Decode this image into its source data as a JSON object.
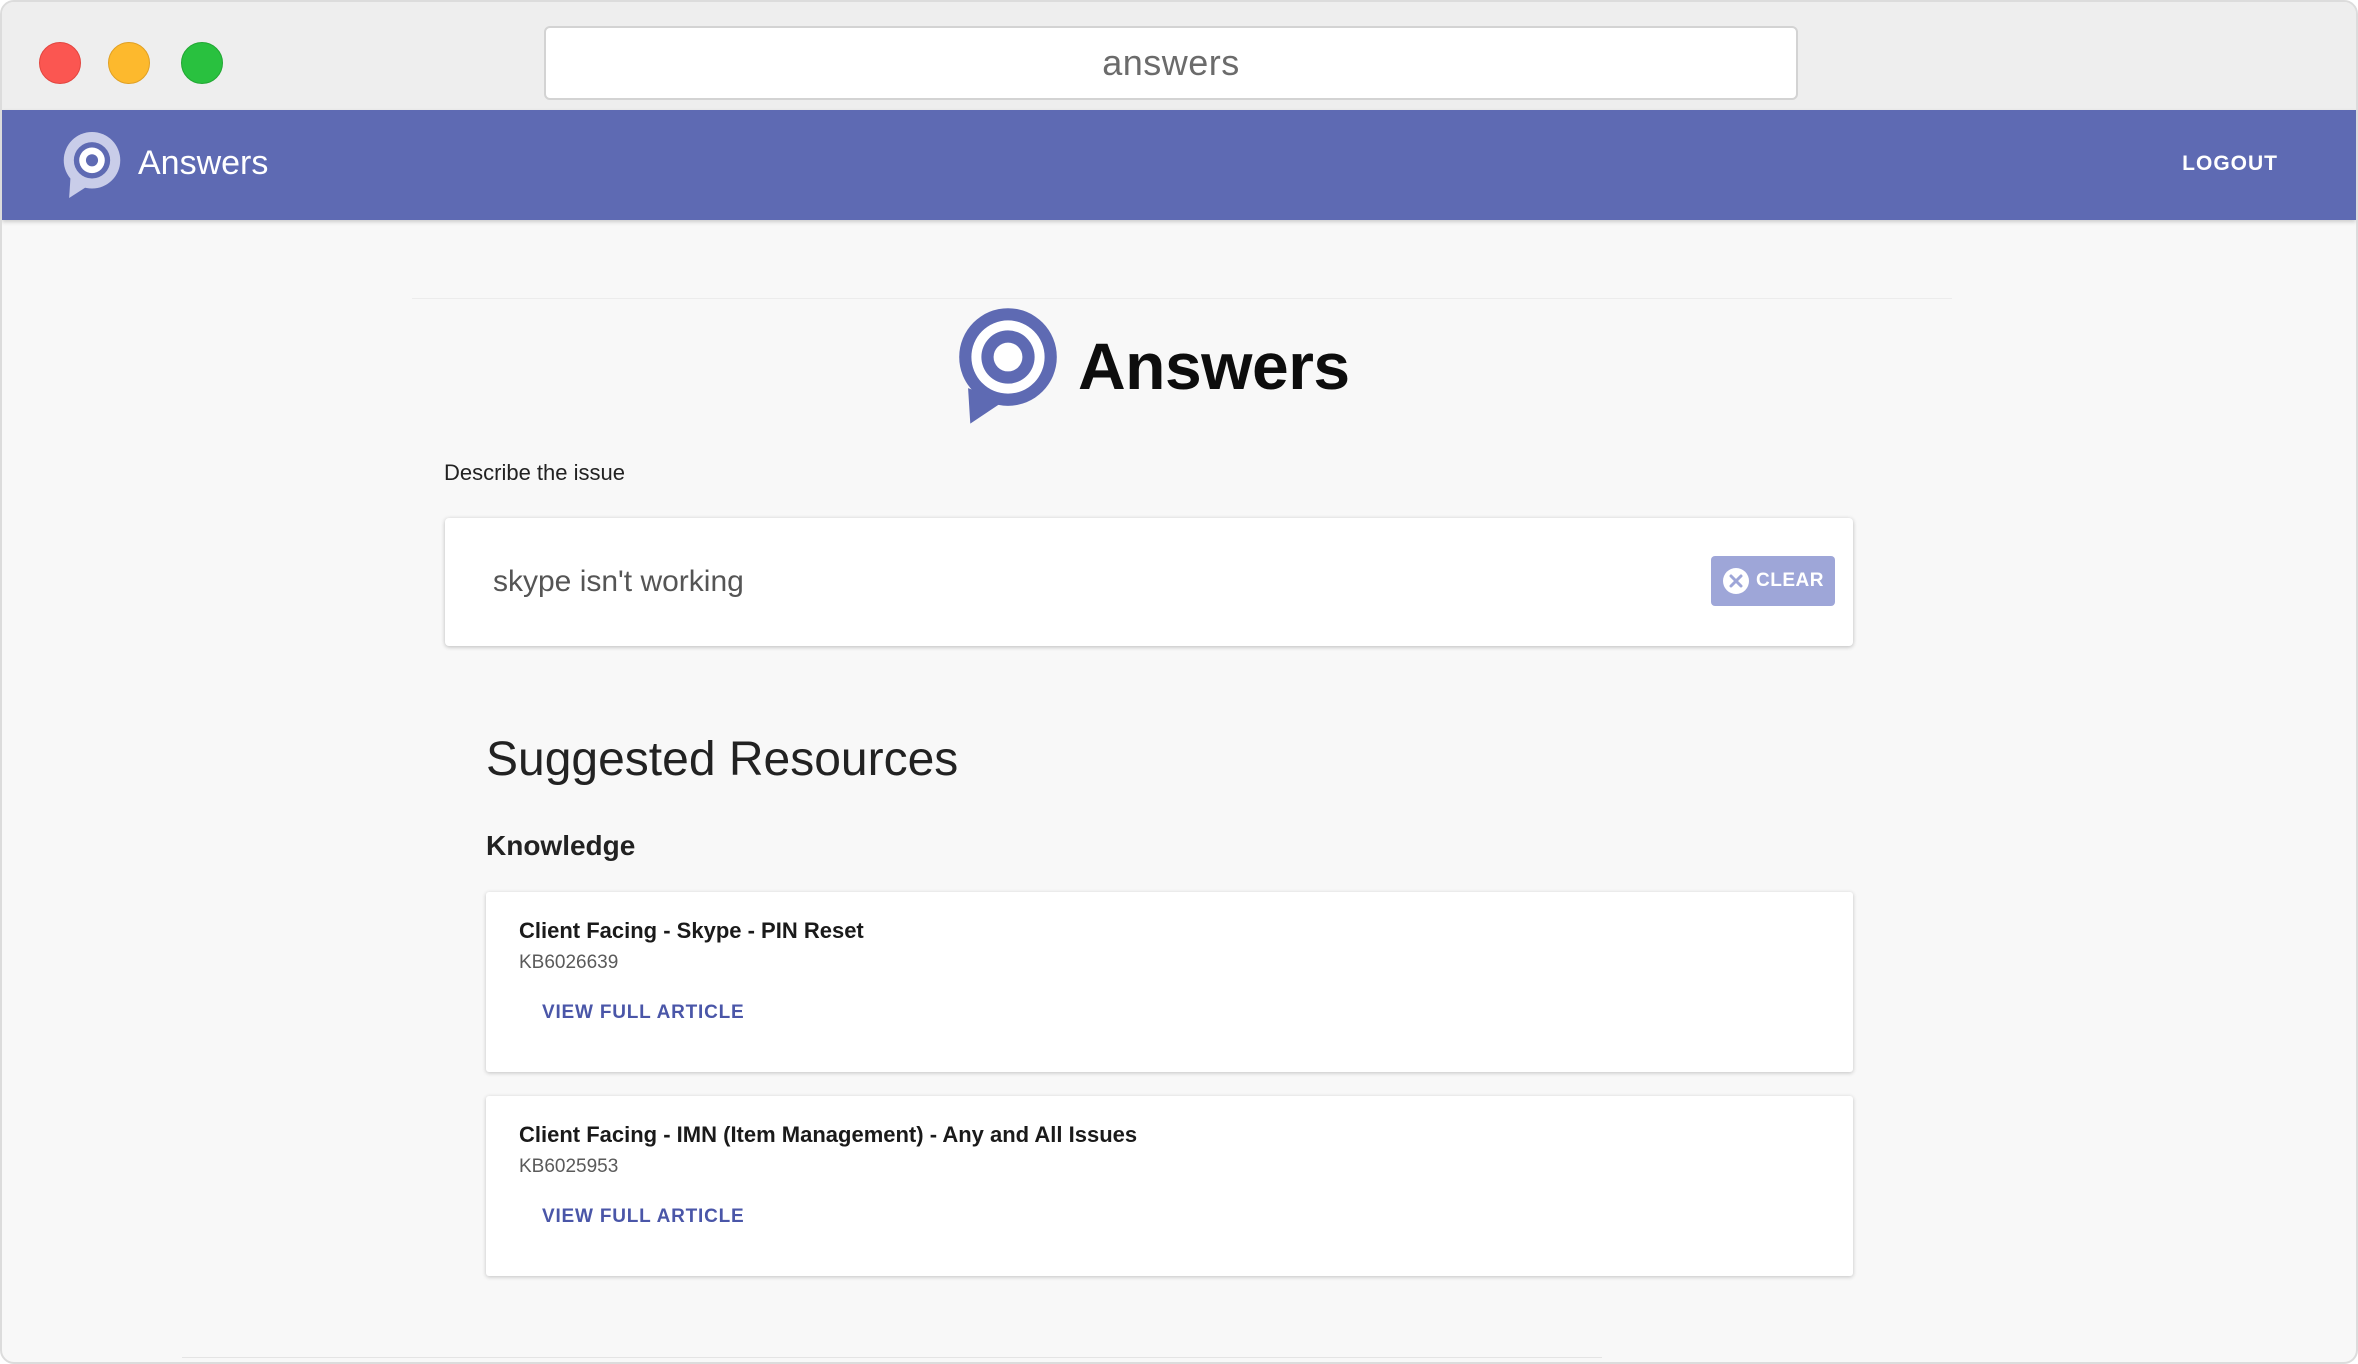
{
  "browser": {
    "url_text": "answers"
  },
  "header": {
    "app_name": "Answers",
    "logout_label": "LOGOUT"
  },
  "hero": {
    "title": "Answers"
  },
  "search": {
    "label": "Describe the issue",
    "value": "skype isn't working",
    "clear_label": "CLEAR"
  },
  "results": {
    "heading": "Suggested Resources",
    "section": "Knowledge",
    "articles": [
      {
        "title": "Client Facing - Skype - PIN Reset",
        "id": "KB6026639",
        "link_label": "VIEW FULL ARTICLE"
      },
      {
        "title": "Client Facing - IMN (Item Management) - Any and All Issues",
        "id": "KB6025953",
        "link_label": "VIEW FULL ARTICLE"
      }
    ]
  },
  "colors": {
    "brand": "#5e6ab3",
    "clear_button": "#9ea6d8",
    "link": "#4a56a8"
  },
  "icons": {
    "logo": "chat-bubble-target-icon",
    "clear": "close-circle-icon"
  }
}
